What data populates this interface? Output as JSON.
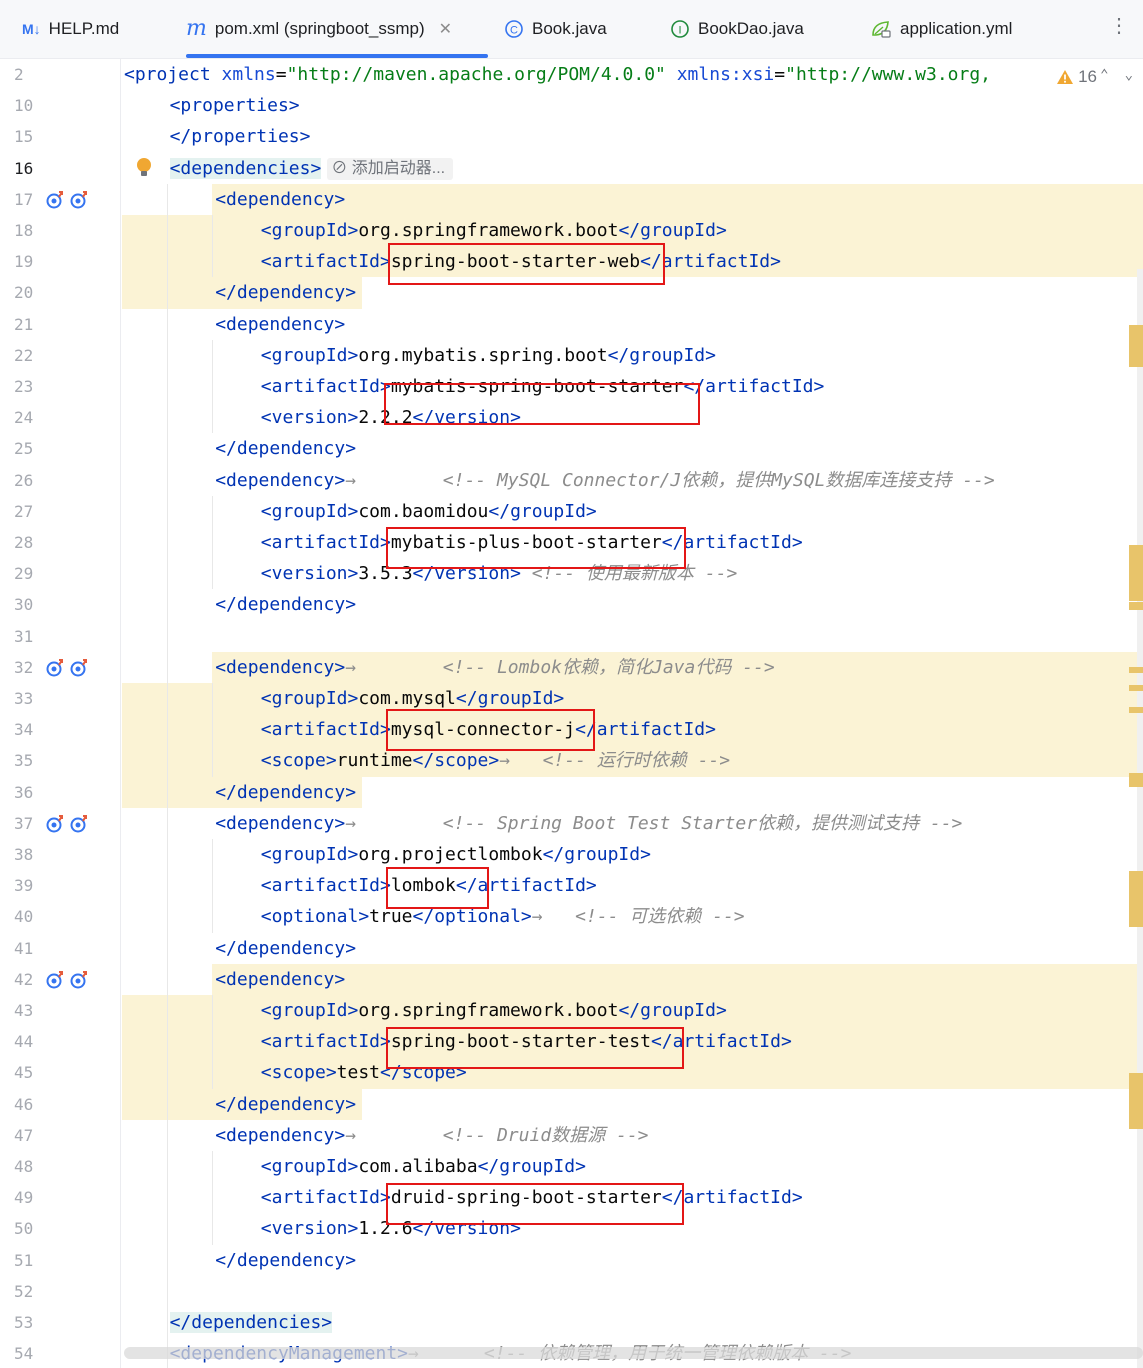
{
  "tabs": [
    {
      "label": "HELP.md",
      "icon": "markdown-icon",
      "glyph": "M↓"
    },
    {
      "label": "pom.xml (springboot_ssmp)",
      "icon": "maven-icon",
      "glyph": "m",
      "active": true,
      "closable": true
    },
    {
      "label": "Book.java",
      "icon": "class-icon",
      "glyph": "C"
    },
    {
      "label": "BookDao.java",
      "icon": "interface-icon",
      "glyph": "I"
    },
    {
      "label": "application.yml",
      "icon": "spring-config-icon",
      "glyph": ""
    }
  ],
  "more_menu_glyph": "⋮",
  "warnings": {
    "count": "16",
    "icon": "warning-icon"
  },
  "hint_chip": {
    "label": "添加启动器..."
  },
  "colors": {
    "accent": "#3574f0",
    "highlight_red": "#e31717",
    "tag": "#0033b3",
    "string": "#067d17",
    "comment": "#8c8c8c",
    "line_highlight": "#fbf3d5"
  },
  "lines": [
    {
      "num": "2",
      "indent": 0,
      "parts": [
        [
          "t",
          "<project "
        ],
        [
          "a",
          "xmlns"
        ],
        [
          "p",
          "="
        ],
        [
          "s",
          "\"http://maven.apache.org/POM/4.0.0\""
        ],
        [
          "p",
          " "
        ],
        [
          "a",
          "xmlns:xsi"
        ],
        [
          "p",
          "="
        ],
        [
          "s",
          "\"http://www.w3.org,"
        ]
      ]
    },
    {
      "num": "10",
      "indent": 1,
      "parts": [
        [
          "t",
          "<properties>"
        ]
      ]
    },
    {
      "num": "15",
      "indent": 1,
      "parts": [
        [
          "t",
          "</properties>"
        ]
      ]
    },
    {
      "num": "16",
      "indent": 1,
      "parts": [
        [
          "tb",
          "<dependencies>"
        ]
      ],
      "current": true,
      "bulb": true,
      "chip": true
    },
    {
      "num": "17",
      "indent": 2,
      "parts": [
        [
          "t",
          "<dependency>"
        ]
      ],
      "gutter_icons": true
    },
    {
      "num": "18",
      "indent": 3,
      "parts": [
        [
          "t",
          "<groupId>"
        ],
        [
          "p",
          "org.springframework.boot"
        ],
        [
          "t",
          "</groupId>"
        ]
      ]
    },
    {
      "num": "19",
      "indent": 3,
      "parts": [
        [
          "t",
          "<artifactId>"
        ],
        [
          "p",
          "spring-boot-starter-web"
        ],
        [
          "t",
          "</artifactId>"
        ]
      ]
    },
    {
      "num": "20",
      "indent": 2,
      "parts": [
        [
          "t",
          "</dependency>"
        ]
      ]
    },
    {
      "num": "21",
      "indent": 2,
      "parts": [
        [
          "t",
          "<dependency>"
        ]
      ]
    },
    {
      "num": "22",
      "indent": 3,
      "parts": [
        [
          "t",
          "<groupId>"
        ],
        [
          "p",
          "org.mybatis.spring.boot"
        ],
        [
          "t",
          "</groupId>"
        ]
      ]
    },
    {
      "num": "23",
      "indent": 3,
      "parts": [
        [
          "t",
          "<artifactId>"
        ],
        [
          "p",
          "mybatis-spring-boot-starter"
        ],
        [
          "t",
          "</artifactId>"
        ]
      ]
    },
    {
      "num": "24",
      "indent": 3,
      "parts": [
        [
          "t",
          "<version>"
        ],
        [
          "p",
          "2.2.2"
        ],
        [
          "t",
          "</version>"
        ]
      ]
    },
    {
      "num": "25",
      "indent": 2,
      "parts": [
        [
          "t",
          "</dependency>"
        ]
      ]
    },
    {
      "num": "26",
      "indent": 2,
      "parts": [
        [
          "t",
          "<dependency>"
        ],
        [
          "r",
          "→"
        ],
        [
          "p",
          "        "
        ],
        [
          "c",
          "<!-- MySQL Connector/J依赖，提供MySQL数据库连接支持 -->"
        ]
      ]
    },
    {
      "num": "27",
      "indent": 3,
      "parts": [
        [
          "t",
          "<groupId>"
        ],
        [
          "p",
          "com.baomidou"
        ],
        [
          "t",
          "</groupId>"
        ]
      ]
    },
    {
      "num": "28",
      "indent": 3,
      "parts": [
        [
          "t",
          "<artifactId>"
        ],
        [
          "p",
          "mybatis-plus-boot-starter"
        ],
        [
          "t",
          "</artifactId>"
        ]
      ]
    },
    {
      "num": "29",
      "indent": 3,
      "parts": [
        [
          "t",
          "<version>"
        ],
        [
          "p",
          "3.5.3"
        ],
        [
          "t",
          "</version>"
        ],
        [
          "p",
          " "
        ],
        [
          "c",
          "<!-- 使用最新版本 -->"
        ]
      ]
    },
    {
      "num": "30",
      "indent": 2,
      "parts": [
        [
          "t",
          "</dependency>"
        ]
      ]
    },
    {
      "num": "31",
      "indent": 0,
      "parts": []
    },
    {
      "num": "32",
      "indent": 2,
      "parts": [
        [
          "t",
          "<dependency>"
        ],
        [
          "r",
          "→"
        ],
        [
          "p",
          "        "
        ],
        [
          "c",
          "<!-- Lombok依赖，简化Java代码 -->"
        ]
      ],
      "gutter_icons": true
    },
    {
      "num": "33",
      "indent": 3,
      "parts": [
        [
          "t",
          "<groupId>"
        ],
        [
          "p",
          "com.mysql"
        ],
        [
          "t",
          "</groupId>"
        ]
      ]
    },
    {
      "num": "34",
      "indent": 3,
      "parts": [
        [
          "t",
          "<artifactId>"
        ],
        [
          "p",
          "mysql-connector-j"
        ],
        [
          "t",
          "</artifactId>"
        ]
      ]
    },
    {
      "num": "35",
      "indent": 3,
      "parts": [
        [
          "t",
          "<scope>"
        ],
        [
          "p",
          "runtime"
        ],
        [
          "t",
          "</scope>"
        ],
        [
          "r",
          "→"
        ],
        [
          "p",
          "   "
        ],
        [
          "c",
          "<!-- 运行时依赖 -->"
        ]
      ]
    },
    {
      "num": "36",
      "indent": 2,
      "parts": [
        [
          "t",
          "</dependency>"
        ]
      ]
    },
    {
      "num": "37",
      "indent": 2,
      "parts": [
        [
          "t",
          "<dependency>"
        ],
        [
          "r",
          "→"
        ],
        [
          "p",
          "        "
        ],
        [
          "c",
          "<!-- Spring Boot Test Starter依赖，提供测试支持 -->"
        ]
      ],
      "gutter_icons": true
    },
    {
      "num": "38",
      "indent": 3,
      "parts": [
        [
          "t",
          "<groupId>"
        ],
        [
          "p",
          "org.projectlombok"
        ],
        [
          "t",
          "</groupId>"
        ]
      ]
    },
    {
      "num": "39",
      "indent": 3,
      "parts": [
        [
          "t",
          "<artifactId>"
        ],
        [
          "p",
          "lombok"
        ],
        [
          "t",
          "</artifactId>"
        ]
      ]
    },
    {
      "num": "40",
      "indent": 3,
      "parts": [
        [
          "t",
          "<optional>"
        ],
        [
          "p",
          "true"
        ],
        [
          "t",
          "</optional>"
        ],
        [
          "r",
          "→"
        ],
        [
          "p",
          "   "
        ],
        [
          "c",
          "<!-- 可选依赖 -->"
        ]
      ]
    },
    {
      "num": "41",
      "indent": 2,
      "parts": [
        [
          "t",
          "</dependency>"
        ]
      ]
    },
    {
      "num": "42",
      "indent": 2,
      "parts": [
        [
          "t",
          "<dependency>"
        ]
      ],
      "gutter_icons": true
    },
    {
      "num": "43",
      "indent": 3,
      "parts": [
        [
          "t",
          "<groupId>"
        ],
        [
          "p",
          "org.springframework.boot"
        ],
        [
          "t",
          "</groupId>"
        ]
      ]
    },
    {
      "num": "44",
      "indent": 3,
      "parts": [
        [
          "t",
          "<artifactId>"
        ],
        [
          "p",
          "spring-boot-starter-test"
        ],
        [
          "t",
          "</artifactId>"
        ]
      ]
    },
    {
      "num": "45",
      "indent": 3,
      "parts": [
        [
          "t",
          "<scope>"
        ],
        [
          "p",
          "test"
        ],
        [
          "t",
          "</scope>"
        ]
      ]
    },
    {
      "num": "46",
      "indent": 2,
      "parts": [
        [
          "t",
          "</dependency>"
        ]
      ]
    },
    {
      "num": "47",
      "indent": 2,
      "parts": [
        [
          "t",
          "<dependency>"
        ],
        [
          "r",
          "→"
        ],
        [
          "p",
          "        "
        ],
        [
          "c",
          "<!-- Druid数据源 -->"
        ]
      ]
    },
    {
      "num": "48",
      "indent": 3,
      "parts": [
        [
          "t",
          "<groupId>"
        ],
        [
          "p",
          "com.alibaba"
        ],
        [
          "t",
          "</groupId>"
        ]
      ]
    },
    {
      "num": "49",
      "indent": 3,
      "parts": [
        [
          "t",
          "<artifactId>"
        ],
        [
          "p",
          "druid-spring-boot-starter"
        ],
        [
          "t",
          "</artifactId>"
        ]
      ]
    },
    {
      "num": "50",
      "indent": 3,
      "parts": [
        [
          "t",
          "<version>"
        ],
        [
          "p",
          "1.2.6"
        ],
        [
          "t",
          "</version>"
        ]
      ]
    },
    {
      "num": "51",
      "indent": 2,
      "parts": [
        [
          "t",
          "</dependency>"
        ]
      ]
    },
    {
      "num": "52",
      "indent": 0,
      "parts": []
    },
    {
      "num": "53",
      "indent": 1,
      "parts": [
        [
          "tb",
          "</dependencies>"
        ]
      ]
    },
    {
      "num": "54",
      "indent": 1,
      "parts": [
        [
          "t",
          "<dependencyManagement>"
        ],
        [
          "r",
          "→"
        ],
        [
          "p",
          "      "
        ],
        [
          "c",
          "<!-- 依赖管理，用于统一管理依赖版本 -->"
        ]
      ]
    }
  ]
}
